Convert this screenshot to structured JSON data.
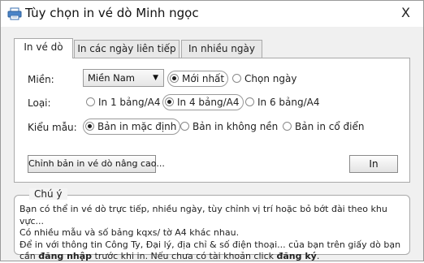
{
  "window": {
    "title": "Tùy chọn in vé dò Minh ngọc",
    "close_label": "X"
  },
  "tabs": [
    {
      "label": "In vé dò"
    },
    {
      "label": "In các ngày liên tiếp"
    },
    {
      "label": "In nhiều ngày"
    }
  ],
  "form": {
    "region_label": "Miền:",
    "region_value": "Miền Nam",
    "date_options": [
      "Mới nhất",
      "Chọn ngày"
    ],
    "type_label": "Loại:",
    "type_options": [
      "In 1 bảng/A4",
      "In 4 bảng/A4",
      "In 6 bảng/A4"
    ],
    "template_label": "Kiểu mẫu:",
    "template_options": [
      "Bản in mặc định",
      "Bản in không nền",
      "Bản in cổ điển"
    ]
  },
  "buttons": {
    "advanced_label": "Chỉnh bản in vé dò nâng cao...",
    "print_label": "In"
  },
  "note": {
    "title": "Chú ý",
    "line1": "Bạn có thể in vé dò trực tiếp, nhiều ngày, tùy chỉnh vị trí hoặc bỏ bớt đài theo khu vực...",
    "line2": "Có nhiều mẫu và số bảng kqxs/ tờ A4 khác nhau.",
    "line3": "Để in với thông tin Công Ty, Đại lý, địa chỉ & số điện thoại... của bạn trên giấy dò bạn",
    "line4_a": "cần ",
    "login_text": "đăng nhập",
    "line4_b": " trước khi in. Nếu chưa có tài khoản click ",
    "register_text": "đăng ký",
    "line4_c": "."
  }
}
